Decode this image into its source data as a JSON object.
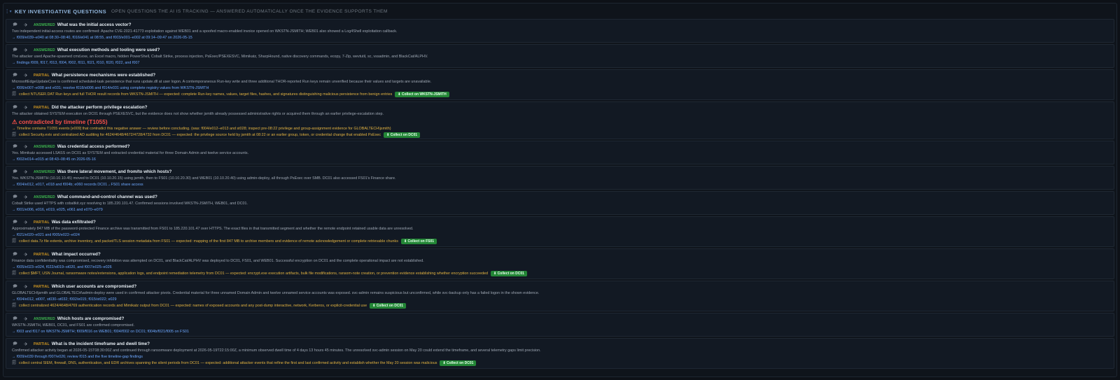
{
  "header": {
    "title": "KEY INVESTIGATIVE QUESTIONS",
    "subtitle": "OPEN QUESTIONS THE AI IS TRACKING — ANSWERED AUTOMATICALLY ONCE THE EVIDENCE SUPPORTS THEM",
    "grip_icon": "drag-grip-icon",
    "caret_icon": "caret-down-icon"
  },
  "colors": {
    "answered": "#3fb950",
    "partial": "#d29922",
    "refs": "#6ea8ff",
    "collect_button": "#238636",
    "contradiction": "#f85149"
  },
  "questions": [
    {
      "status": "ANSWERED",
      "question": "What was the initial access vector?",
      "answer": "Two independent initial-access routes are confirmed: Apache CVE-2021-41773 exploitation against WEB01 and a spoofed macro-enabled invoice opened on WKSTN-JSMITH; WEB01 also showed a Log4Shell exploitation callback.",
      "refs": "→ f009/e039–e040 at 08:30–08:40, f016/e041 at 08:55, and f003/e001–e002 at 09:14–09:47 on 2026-05-15"
    },
    {
      "status": "ANSWERED",
      "question": "What execution methods and tooling were used?",
      "answer": "The attacker used Apache-spawned cmd.exe, an Excel macro, hidden PowerShell, Cobalt Strike, process injection, PsExec/PSEXESVC, Mimikatz, SharpHound, native discovery commands, ecopy, 7-Zip, wevtutil, sc, vssadmin, and BlackCat/ALPHV.",
      "refs": "→ findings f009, f017, f013, f004, f002, f011, f021, f010, f020, f022, and f007"
    },
    {
      "status": "PARTIAL",
      "question": "What persistence mechanisms were established?",
      "answer": "MicrosoftEdgeUpdateCore is confirmed scheduled-task persistence that runs update.dll at user logon. A contemporaneous Run-key write and three additional THOR-reported Run keys remain unverified because their values and targets are unavailable.",
      "refs": "→ f006/e007–e008 and e031; resolve f018/st006 and f014/e031 using complete registry values from WKSTN-JSMITH",
      "collect": "collect NTUSER.DAT Run keys and full THOR result records from WKSTN-JSMITH — expected: complete Run-key names, values, target files, hashes, and signatures distinguishing malicious persistence from benign entries",
      "collect_button": "⬇ Collect on WKSTN-JSMITH"
    },
    {
      "status": "PARTIAL",
      "question": "Did the attacker perform privilege escalation?",
      "answer": "The attacker obtained SYSTEM execution on DC01 through PSEXESVC, but the evidence does not show whether jsmith already possessed administrative rights or acquired them through an earlier privilege-escalation step.",
      "contradiction": "⚠ contradicted by timeline (T1055)",
      "warning": "→ Timeline contains T1055 events [e009] that contradict this negative answer — review before concluding. (was: f004/e012–e013 and st028; inspect pre-08:22 privilege and group-assignment evidence for GLOBALTECH\\jsmith)",
      "collect": "collect Security.evtx and centralized AD auditing for 4624/4648/4672/4728/4732 from DC01 — expected: the privilege source held by jsmith at 08:22 or an earlier group, token, or credential change that enabled PsExec",
      "collect_button": "⬇ Collect on DC01"
    },
    {
      "status": "ANSWERED",
      "question": "Was credential access performed?",
      "answer": "Yes. Mimikatz accessed LSASS on DC01 as SYSTEM and extracted credential material for three Domain Admin and twelve service accounts.",
      "refs": "→ f002/e014–e015 at 08:43–08:45 on 2026-05-16"
    },
    {
      "status": "ANSWERED",
      "question": "Was there lateral movement, and from/to which hosts?",
      "answer": "Yes. WKSTN-JSMITH (10.10.10.45) moved to DC01 (10.10.20.15) using jsmith, then to FS01 (10.10.20.30) and WEB01 (10.10.20.40) using admin-deploy, all through PsExec over SMB. DC01 also accessed FS01's Finance share.",
      "refs": "→ f004/e012, e017, e018 and f004b; e060 records DC01→FS01 share access"
    },
    {
      "status": "ANSWERED",
      "question": "What command-and-control channel was used?",
      "answer": "Cobalt Strike used HTTPS with cobaltkit.xyz resolving to 185.220.101.47. Confirmed sessions involved WKSTN-JSMITH, WEB01, and DC01.",
      "refs": "→ f001/e006, e016, e019, e025, e061 and e070–e079"
    },
    {
      "status": "PARTIAL",
      "question": "Was data exfiltrated?",
      "answer": "Approximately 847 MB of the password-protected Finance archive was transmitted from FS01 to 185.220.101.47 over HTTPS. The exact files in that transmitted segment and whether the remote endpoint retained usable data are unresolved.",
      "refs": "→ f021/e020–e021 and f005/e022–e024",
      "collect": "collect data.7z file extents, archive inventory, and packet/TLS session metadata from FS01 — expected: mapping of the first 847 MB to archive members and evidence of remote acknowledgement or complete retrievable chunks",
      "collect_button": "⬇ Collect on FS01"
    },
    {
      "status": "PARTIAL",
      "question": "What impact occurred?",
      "answer": "Finance data confidentiality was compromised, recovery inhibition was attempted on DC01, and BlackCat/ALPHV was deployed to DC01, FS01, and WEB01. Successful encryption on DC01 and the complete operational impact are not established.",
      "refs": "→ f005/e023–e024, f022/st019–st020, and f007/e025–e026",
      "collect": "collect $MFT, USN Journal, ransomware notes/extensions, application logs, and endpoint remediation telemetry from DC01 — expected: encrypt.exe execution artifacts, bulk file modifications, ransom-note creation, or prevention evidence establishing whether encryption succeeded",
      "collect_button": "⬇ Collect on DC01"
    },
    {
      "status": "PARTIAL",
      "question": "Which user accounts are compromised?",
      "answer": "GLOBALTECH\\jsmith and GLOBALTECH\\admin-deploy were used in confirmed attacker pivots. Credential material for three unnamed Domain Admin and twelve unnamed service accounts was exposed. svc-admin remains suspicious but unconfirmed, while svc-backup only has a failed logon in the shown evidence.",
      "refs": "→ f004/e012, st007, st030–st032; f002/e015; f015/st022; e029",
      "collect": "collect centralized 4624/4648/4769 authentication records and Mimikatz output from DC01 — expected: names of exposed accounts and any post-dump interactive, network, Kerberos, or explicit-credential use",
      "collect_button": "⬇ Collect on DC01"
    },
    {
      "status": "ANSWERED",
      "question": "Which hosts are compromised?",
      "answer": "WKSTN-JSMITH, WEB01, DC01, and FS01 are confirmed compromised.",
      "refs": "→ f003 and f017 on WKSTN-JSMITH; f009/f016 on WEB01; f004/f002 on DC01; f004b/f021/f005 on FS01"
    },
    {
      "status": "PARTIAL",
      "question": "What is the incident timeframe and dwell time?",
      "answer": "Confirmed attacker activity began at 2026-05-15T08:30:00Z and continued through ransomware deployment at 2026-05-19T22:15:00Z, a minimum observed dwell time of 4 days 13 hours 45 minutes. The unresolved svc-admin session on May 20 could extend the timeframe, and several telemetry gaps limit precision.",
      "refs": "→ f009/e039 through f007/e026; review f015 and the five timeline-gap findings",
      "collect": "collect central SIEM, firewall, DNS, authentication, and EDR archives spanning the silent periods from DC01 — expected: additional attacker events that refine the first and last confirmed activity and establish whether the May 20 session was malicious",
      "collect_button": "⬇ Collect on DC01"
    }
  ]
}
